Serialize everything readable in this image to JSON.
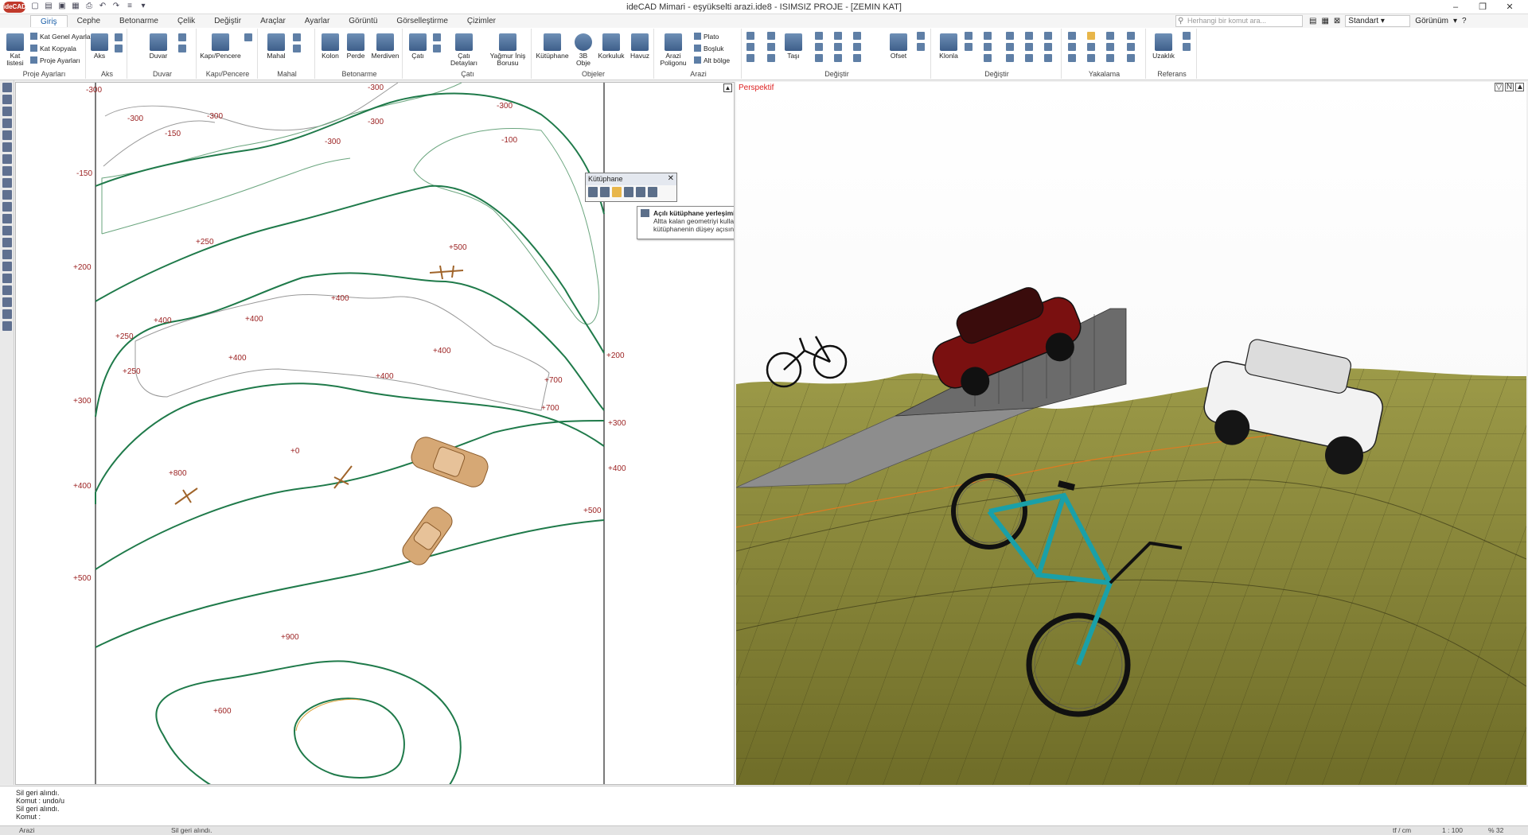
{
  "app": {
    "logo": "ideCAD",
    "title": "ideCAD Mimari - eşyükselti arazi.ide8 - ISIMSIZ PROJE - [ZEMIN KAT]"
  },
  "menu_tabs": [
    "Giriş",
    "Cephe",
    "Betonarme",
    "Çelik",
    "Değiştir",
    "Araçlar",
    "Ayarlar",
    "Görüntü",
    "Görselleştirme",
    "Çizimler"
  ],
  "search": {
    "placeholder": "Herhangi bir komut ara..."
  },
  "style_select": {
    "value": "Standart"
  },
  "view_label": "Görünüm",
  "ribbon": {
    "proje_ayarlari": {
      "kat_listesi": "Kat listesi",
      "kat_genel": "Kat Genel Ayarları",
      "kat_kopyala": "Kat Kopyala",
      "proje_ayarlari_btn": "Proje Ayarları",
      "label": "Proje Ayarları"
    },
    "aks": {
      "btn": "Aks",
      "label": "Aks"
    },
    "duvar": {
      "btn": "Duvar",
      "label": "Duvar"
    },
    "kapi": {
      "btn": "Kapı/Pencere",
      "label": "Kapı/Pencere"
    },
    "mahal": {
      "btn": "Mahal",
      "label": "Mahal"
    },
    "betonarme": {
      "kolon": "Kolon",
      "perde": "Perde",
      "merdiven": "Merdiven",
      "label": "Betonarme"
    },
    "cati": {
      "cati": "Çatı",
      "cati_detay": "Çatı Detayları",
      "yagmur": "Yağmur İniş Borusu",
      "label": "Çatı"
    },
    "objeler": {
      "kutuphane": "Kütüphane",
      "obje3b": "3B Obje",
      "korkuluk": "Korkuluk",
      "havuz": "Havuz",
      "label": "Objeler"
    },
    "arazi": {
      "poligon": "Arazi Poligonu",
      "plato": "Plato",
      "bosluk": "Boşluk",
      "alt_bolge": "Alt bölge",
      "label": "Arazi"
    },
    "degistir": {
      "tasi": "Taşı",
      "ofset": "Ofset",
      "label": "Değiştir"
    },
    "degistir2": {
      "klonla": "Klonla",
      "label": "Değiştir"
    },
    "yakalama": {
      "label": "Yakalama"
    },
    "referans": {
      "uzaklik": "Uzaklık",
      "label": "Referans"
    }
  },
  "plan": {
    "labels": [
      "-300",
      "-300",
      "-300",
      "-300",
      "-300",
      "-300",
      "-300",
      "-150",
      "-150",
      "-100",
      "+250",
      "+500",
      "+200",
      "+400",
      "+400",
      "+400",
      "+250",
      "+250",
      "+400",
      "+400",
      "+400",
      "+700",
      "+700",
      "+200",
      "+300",
      "+300",
      "+0",
      "+800",
      "+400",
      "+400",
      "+500",
      "+500",
      "+900",
      "+600"
    ]
  },
  "view3d": {
    "label": "Perspektif"
  },
  "library_panel": {
    "title": "Kütüphane"
  },
  "tooltip": {
    "title": "Açılı kütüphane yerleşimi",
    "line1": "Altta kalan geometriyi kullarak,",
    "line2": "kütüphanenin düşey açısını ayarlar."
  },
  "command_log": [
    "Sil geri alındı.",
    "Komut : undo/u",
    "Sil geri alındı.",
    "Komut :"
  ],
  "status": {
    "left": "Arazi",
    "msg": "Sil geri alındı.",
    "unit": "tf / cm",
    "scale": "1 : 100",
    "zoom": "% 32"
  },
  "colors": {
    "contour_main": "#1f7a4a",
    "contour_thin": "#8e8e8e",
    "label_red": "#9a1f1f",
    "terrain": "#8c8a3a",
    "accent_blue": "#1b5fa8"
  }
}
